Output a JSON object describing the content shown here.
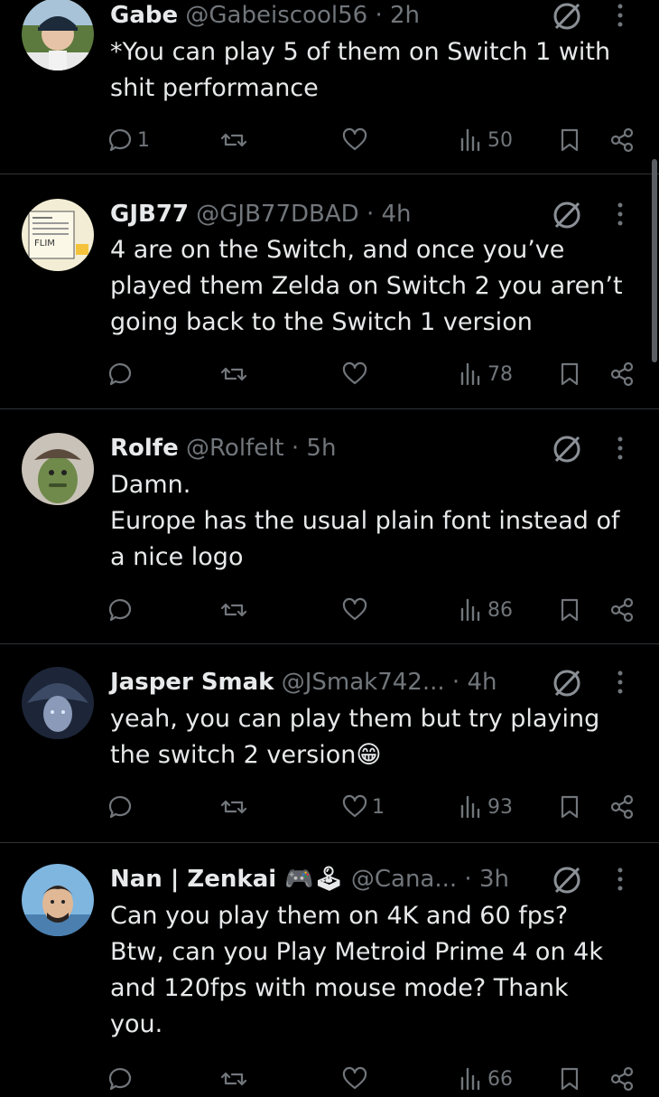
{
  "tweets": [
    {
      "name": "Gabe",
      "handle": "@Gabeiscool56",
      "time": "· 2h",
      "text": "*You can play 5 of them on Switch 1 with\nshit performance",
      "replies": "1",
      "retweets": "",
      "likes": "",
      "views": "50"
    },
    {
      "name": "GJB77",
      "handle": "@GJB77DBAD",
      "time": "· 4h",
      "text": "4 are on the Switch, and once you’ve\nplayed them Zelda on Switch 2 you aren’t\ngoing back to the Switch 1 version",
      "replies": "",
      "retweets": "",
      "likes": "",
      "views": "78"
    },
    {
      "name": "Rolfe",
      "handle": "@Rolfelt",
      "time": "· 5h",
      "text": "Damn.\nEurope has the usual plain font instead of\na nice logo",
      "replies": "",
      "retweets": "",
      "likes": "",
      "views": "86"
    },
    {
      "name": "Jasper Smak",
      "handle": "@JSmak742...",
      "time": "· 4h",
      "text": "yeah, you can play them but try playing\nthe switch 2 version😁",
      "replies": "",
      "retweets": "",
      "likes": "1",
      "views": "93"
    },
    {
      "name": "Nan | Zenkai 🎮🕹",
      "handle": "@Cana...",
      "time": "· 3h",
      "text": "Can you play them on 4K and 60 fps?\nBtw, can you Play Metroid Prime 4 on 4k\nand 120fps with mouse mode? Thank\nyou.",
      "replies": "",
      "retweets": "",
      "likes": "",
      "views": "66"
    }
  ],
  "colors": {
    "background": "#000000",
    "text": "#e7e9ea",
    "muted": "#71767b",
    "divider": "#2f3336"
  },
  "icons": [
    "reply-icon",
    "retweet-icon",
    "like-icon",
    "views-icon",
    "bookmark-icon",
    "share-icon",
    "grok-icon",
    "more-icon"
  ]
}
